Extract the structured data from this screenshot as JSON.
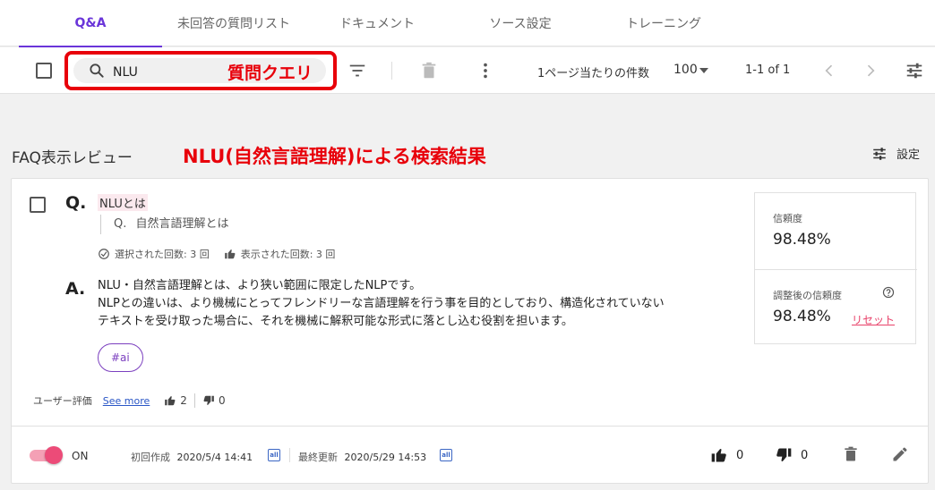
{
  "tabs": [
    {
      "label": "Q&A",
      "active": true
    },
    {
      "label": "未回答の質問リスト",
      "active": false
    },
    {
      "label": "ドキュメント",
      "active": false
    },
    {
      "label": "ソース設定",
      "active": false
    },
    {
      "label": "トレーニング",
      "active": false
    }
  ],
  "toolbar": {
    "search_value": "NLU",
    "annotation_query": "質問クエリ",
    "per_page_label": "1ページ当たりの件数",
    "per_page_value": "100",
    "pagination_range": "1-1 of 1"
  },
  "section": {
    "title": "FAQ表示レビュー",
    "annotation_result": "NLU(自然言語理解)による検索結果",
    "settings_label": "設定"
  },
  "faq": {
    "q_mark": "Q.",
    "a_mark": "A.",
    "question": "NLUとは",
    "alt_question_prefix": "Q.",
    "alt_question": "自然言語理解とは",
    "selected_count": "選択された回数: 3 回",
    "displayed_count": "表示された回数: 3 回",
    "answer_lines": [
      "NLU・自然言語理解とは、より狭い範囲に限定したNLPです。",
      "NLPとの違いは、より機械にとってフレンドリーな言語理解を行う事を目的としており、構造化されていない",
      "テキストを受け取った場合に、それを機械に解釈可能な形式に落とし込む役割を担います。"
    ],
    "tag": "#ai",
    "rating_label": "ユーザー評価",
    "see_more": "See more",
    "likes": "2",
    "dislikes": "0",
    "confidence_label": "信頼度",
    "confidence_value": "98.48%",
    "adjusted_label": "調整後の信頼度",
    "adjusted_value": "98.48%",
    "reset_label": "リセット",
    "toggle_label": "ON",
    "created_label": "初回作成",
    "created_value": "2020/5/4 14:41",
    "updated_label": "最終更新",
    "updated_value": "2020/5/29 14:53",
    "badge_text": "all",
    "footer_likes": "0",
    "footer_dislikes": "0"
  },
  "colors": {
    "accent": "#6a35d9",
    "annotation_red": "#e8000a",
    "toggle_pink": "#ec4b78",
    "link_blue": "#2a56c6"
  }
}
